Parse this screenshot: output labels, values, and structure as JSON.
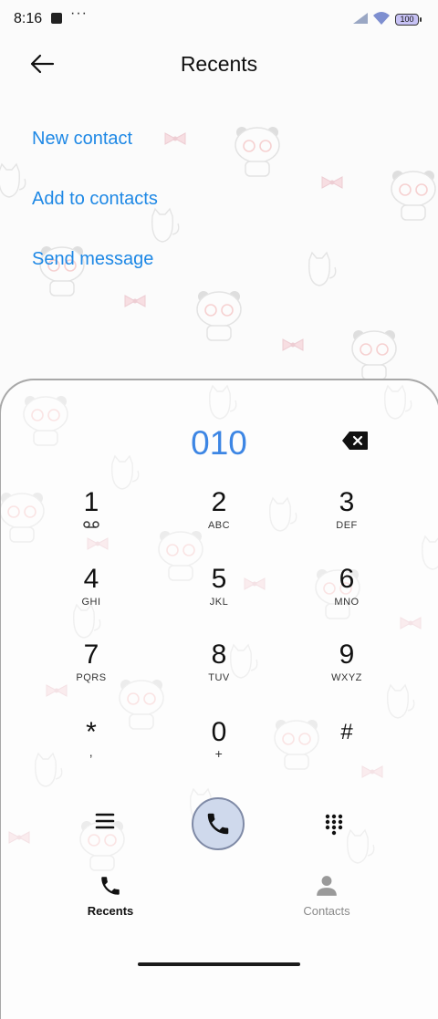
{
  "status_bar": {
    "time": "8:16",
    "more": "···",
    "battery": "100"
  },
  "header": {
    "title": "Recents"
  },
  "actions": [
    {
      "label": "New contact"
    },
    {
      "label": "Add to contacts"
    },
    {
      "label": "Send message"
    }
  ],
  "dialer": {
    "number": "010",
    "keys": [
      {
        "digit": "1",
        "letters": "voicemail-icon"
      },
      {
        "digit": "2",
        "letters": "ABC"
      },
      {
        "digit": "3",
        "letters": "DEF"
      },
      {
        "digit": "4",
        "letters": "GHI"
      },
      {
        "digit": "5",
        "letters": "JKL"
      },
      {
        "digit": "6",
        "letters": "MNO"
      },
      {
        "digit": "7",
        "letters": "PQRS"
      },
      {
        "digit": "8",
        "letters": "TUV"
      },
      {
        "digit": "9",
        "letters": "WXYZ"
      },
      {
        "digit": "*",
        "letters": ","
      },
      {
        "digit": "0",
        "letters": "+"
      },
      {
        "digit": "#",
        "letters": ""
      }
    ]
  },
  "bottom_nav": {
    "recents": "Recents",
    "contacts": "Contacts"
  },
  "colors": {
    "accent": "#1e88e5",
    "number": "#3d86e4",
    "call_button": "#cfd9ec",
    "nav_inactive": "#8a8a8a"
  }
}
